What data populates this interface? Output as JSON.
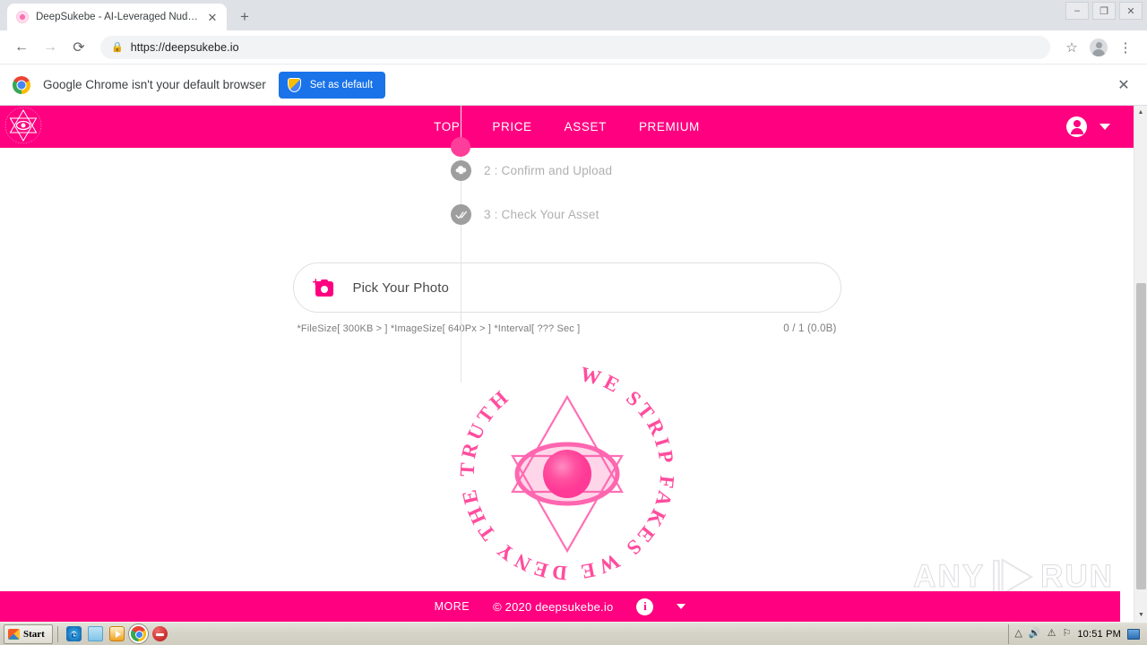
{
  "browser": {
    "tab": {
      "title": "DeepSukebe - AI-Leveraged Nudifier",
      "favicon_name": "site-favicon",
      "close_glyph": "✕"
    },
    "new_tab_glyph": "+",
    "window_controls": {
      "minimize": "–",
      "restore": "❐",
      "close": "✕"
    },
    "nav": {
      "back": "←",
      "forward": "→",
      "reload": "⟳"
    },
    "url": {
      "lock_glyph": "ὑ2",
      "value": "https://deepsukebe.io"
    },
    "toolbar": {
      "bookmark_glyph": "☆",
      "menu_glyph": "⋮"
    }
  },
  "infobar": {
    "message": "Google Chrome isn't your default browser",
    "button_label": "Set as default",
    "close_glyph": "✕"
  },
  "site": {
    "nav_links": [
      "TOP",
      "PRICE",
      "ASSET",
      "PREMIUM"
    ],
    "steps": [
      {
        "badge": "☁",
        "label": "2 : Confirm and Upload"
      },
      {
        "badge": "✔",
        "label": "3 : Check Your Asset"
      }
    ],
    "picker": {
      "label": "Pick Your Photo",
      "constraints": "*FileSize[ 300KB > ] *ImageSize[ 640Px > ] *Interval[ ??? Sec ]",
      "counter": "0 / 1 (0.0B)"
    },
    "emblem": {
      "ring_text": "WE STRIP FAKES WE DENY THE TRUTH",
      "center_icon": "eye-icon"
    },
    "footer": {
      "more_label": "MORE",
      "copyright": "© 2020 deepsukebe.io",
      "info_glyph": "i"
    },
    "colors": {
      "brand_pink": "#FF0080",
      "step_gray": "#9E9E9E",
      "step_text": "#B0B0B0"
    }
  },
  "watermark": {
    "left": "ANY",
    "right": "RUN"
  },
  "taskbar": {
    "start_label": "Start",
    "quick_launch": [
      "internet-explorer-icon",
      "folder-icon",
      "media-player-icon",
      "chrome-icon",
      "stop-icon"
    ],
    "tray_icons": [
      "expand-icon",
      "volume-icon",
      "security-alert-icon",
      "network-icon"
    ],
    "clock": "10:51 PM"
  }
}
